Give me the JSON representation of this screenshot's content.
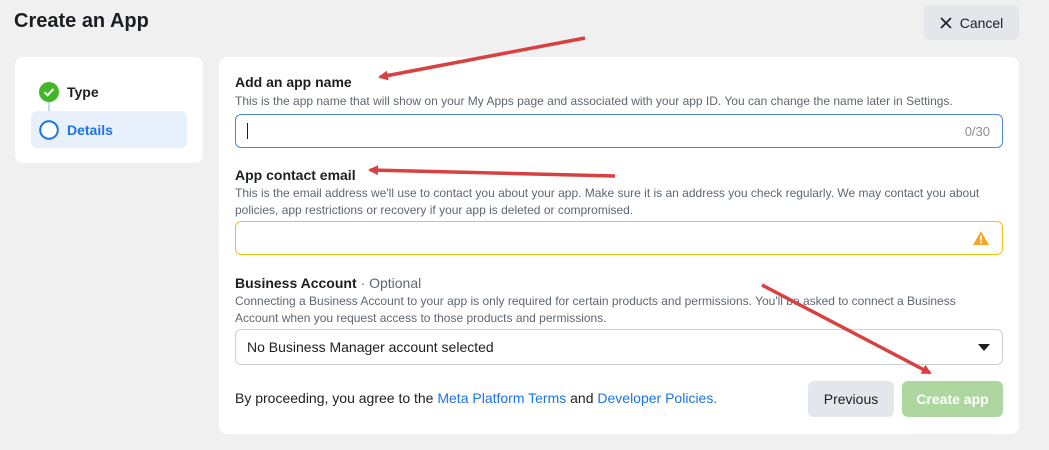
{
  "header": {
    "title": "Create an App",
    "cancel_label": "Cancel"
  },
  "steps": [
    {
      "label": "Type",
      "status": "complete"
    },
    {
      "label": "Details",
      "status": "current"
    }
  ],
  "form": {
    "app_name": {
      "label": "Add an app name",
      "description": "This is the app name that will show on your My Apps page and associated with your app ID. You can change the name later in Settings.",
      "value": "",
      "char_count": "0/30"
    },
    "contact_email": {
      "label": "App contact email",
      "description": "This is the email address we'll use to contact you about your app. Make sure it is an address you check regularly. We may contact you about policies, app restrictions or recovery if your app is deleted or compromised.",
      "value": "",
      "state": "warning"
    },
    "business_account": {
      "label": "Business Account",
      "optional_label": "· Optional",
      "description": "Connecting a Business Account to your app is only required for certain products and permissions. You'll be asked to connect a Business Account when you request access to those products and permissions.",
      "selected": "No Business Manager account selected"
    },
    "terms": {
      "prefix": "By proceeding, you agree to the ",
      "link1": "Meta Platform Terms",
      "middle": " and ",
      "link2": "Developer Policies",
      "suffix": "."
    },
    "previous_label": "Previous",
    "create_label": "Create app"
  },
  "colors": {
    "link": "#1b74e4",
    "success": "#42b72a",
    "create_disabled": "#aed79f",
    "warning": "#f1c40f",
    "annotation_arrow": "#d94040"
  }
}
